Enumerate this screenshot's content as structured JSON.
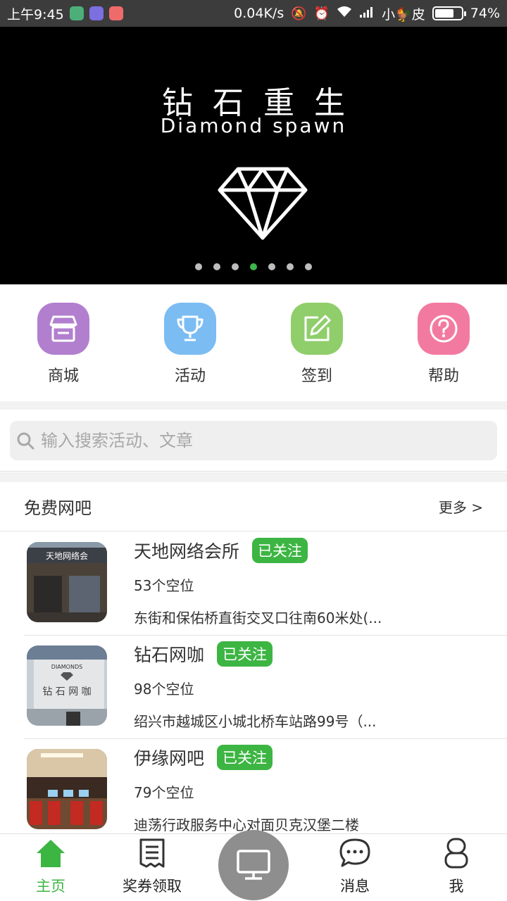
{
  "status_bar": {
    "time": "上午9:45",
    "net_speed": "0.04K/s",
    "carrier": "小🐓皮",
    "battery": "74%",
    "battery_level": 0.74
  },
  "banner": {
    "title": "钻石重生",
    "subtitle": "Diamond spawn",
    "page_count": 7,
    "active_index": 3
  },
  "quick_menu": [
    {
      "label": "商城",
      "icon": "store-icon",
      "color": "#b27fcf"
    },
    {
      "label": "活动",
      "icon": "trophy-icon",
      "color": "#7bbcf3"
    },
    {
      "label": "签到",
      "icon": "edit-icon",
      "color": "#8fce6b"
    },
    {
      "label": "帮助",
      "icon": "help-icon",
      "color": "#f27aa0"
    }
  ],
  "search": {
    "placeholder": "输入搜索活动、文章"
  },
  "section": {
    "title": "免费网吧",
    "more": "更多 >"
  },
  "cafes": [
    {
      "name": "天地网络会所",
      "tag": "已关注",
      "seats": "53个空位",
      "address": "东街和保佑桥直街交叉口往南60米处(..."
    },
    {
      "name": "钻石网咖",
      "tag": "已关注",
      "seats": "98个空位",
      "address": "绍兴市越城区小城北桥车站路99号（..."
    },
    {
      "name": "伊缘网吧",
      "tag": "已关注",
      "seats": "79个空位",
      "address": "迪荡行政服务中心对面贝克汉堡二楼"
    }
  ],
  "bottom_nav": {
    "home": "主页",
    "coupons": "奖券领取",
    "messages": "消息",
    "me": "我"
  },
  "colors": {
    "accent": "#3db543",
    "banner_bg": "#000000"
  }
}
